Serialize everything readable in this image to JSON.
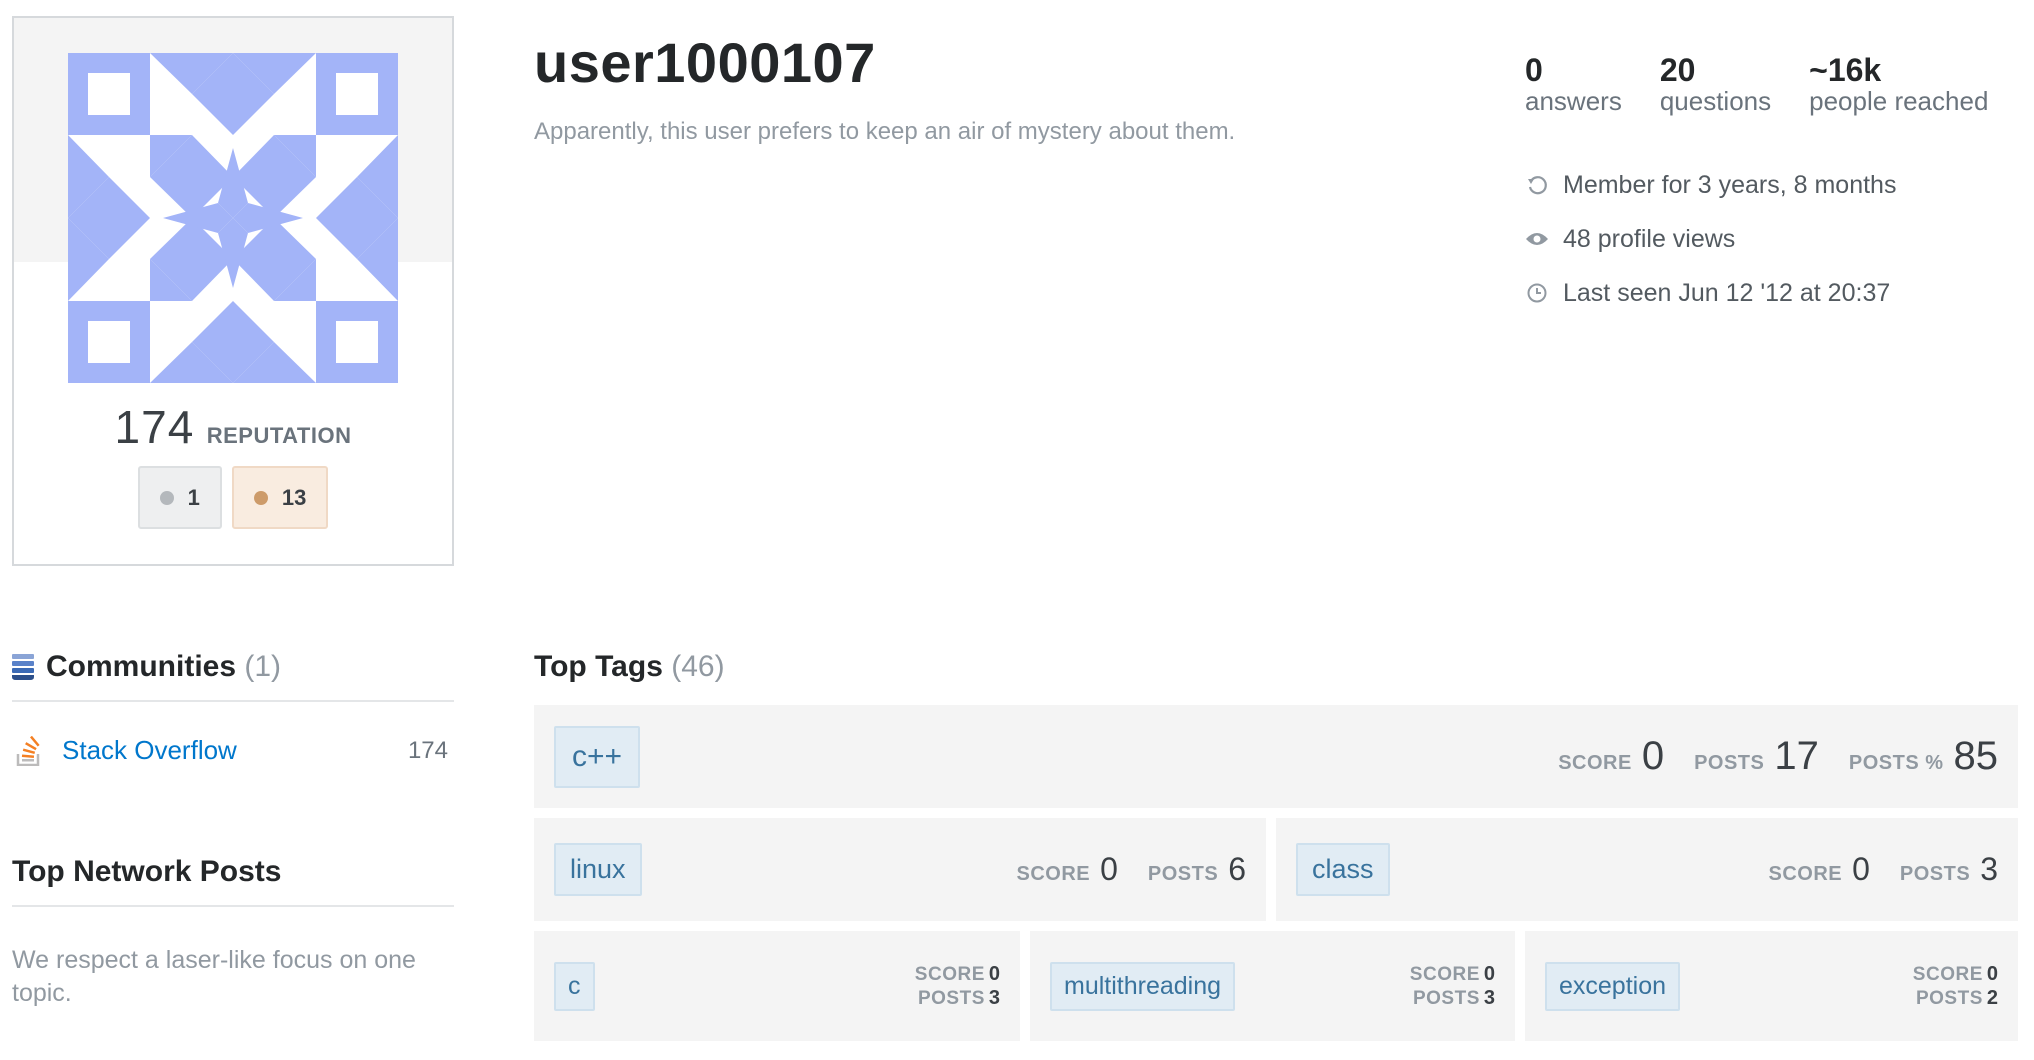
{
  "profile": {
    "username": "user1000107",
    "bio": "Apparently, this user prefers to keep an air of mystery about them.",
    "reputation": "174",
    "reputation_label": "REPUTATION",
    "badges": {
      "silver": "1",
      "bronze": "13"
    }
  },
  "stats": [
    {
      "value": "0",
      "label": "answers"
    },
    {
      "value": "20",
      "label": "questions"
    },
    {
      "value": "~16k",
      "label": "people reached"
    }
  ],
  "meta": {
    "member_for": "Member for 3 years, 8 months",
    "profile_views": "48 profile views",
    "last_seen": "Last seen Jun 12 '12 at 20:37"
  },
  "communities": {
    "title": "Communities",
    "count": "(1)",
    "items": [
      {
        "name": "Stack Overflow",
        "reputation": "174"
      }
    ]
  },
  "network_posts": {
    "title": "Top Network Posts",
    "message": "We respect a laser-like focus on one topic."
  },
  "top_tags": {
    "title": "Top Tags",
    "count": "(46)",
    "labels": {
      "score": "SCORE",
      "posts": "POSTS",
      "posts_pct": "POSTS %"
    },
    "items": [
      {
        "name": "c++",
        "score": "0",
        "posts": "17",
        "posts_pct": "85"
      },
      {
        "name": "linux",
        "score": "0",
        "posts": "6"
      },
      {
        "name": "class",
        "score": "0",
        "posts": "3"
      },
      {
        "name": "c",
        "score": "0",
        "posts": "3"
      },
      {
        "name": "multithreading",
        "score": "0",
        "posts": "3"
      },
      {
        "name": "exception",
        "score": "0",
        "posts": "2"
      }
    ]
  },
  "colors": {
    "avatar": "#a3b4f8",
    "link": "#0077cc",
    "tag_bg": "#e1ecf4",
    "tag_text": "#39739d"
  }
}
